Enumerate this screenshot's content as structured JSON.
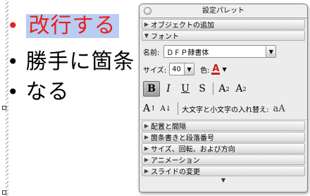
{
  "slide": {
    "lines": [
      {
        "bullet": "•",
        "text": "改行する"
      },
      {
        "bullet": "•",
        "text": "勝手に箇条"
      },
      {
        "bullet": "•",
        "text": "なる"
      }
    ],
    "highlight_text_color": "#e81e1e",
    "selection_color": "#b9cdf2"
  },
  "palette": {
    "title": "設定パレット",
    "sections_top": [
      {
        "label": "オブジェクトの追加",
        "state": "collapsed"
      },
      {
        "label": "フォント",
        "state": "expanded"
      }
    ],
    "font": {
      "name_label": "名前:",
      "name_value": "ＤＦＰ隷書体",
      "size_label": "サイズ:",
      "size_value": "40",
      "color_label": "色:",
      "color_value": "#c42020",
      "style_buttons": [
        {
          "id": "bold",
          "glyph": "B",
          "active": true
        },
        {
          "id": "italic",
          "glyph": "I",
          "active": false
        },
        {
          "id": "underline",
          "glyph": "U",
          "active": false
        },
        {
          "id": "strikethrough",
          "glyph": "S",
          "active": false
        },
        {
          "id": "superscript",
          "glyph": "A",
          "mark": "2",
          "active": false
        },
        {
          "id": "subscript",
          "glyph": "A",
          "mark": "2",
          "active": false
        }
      ],
      "case_label": "大文字と小文字の入れ替え:",
      "case_button": "aA",
      "grow_glyph": "A",
      "shrink_glyph": "A"
    },
    "sections_bottom": [
      {
        "label": "配置と間隔",
        "state": "collapsed"
      },
      {
        "label": "箇条書きと段落番号",
        "state": "collapsed"
      },
      {
        "label": "サイズ、回転、および方向",
        "state": "collapsed"
      },
      {
        "label": "アニメーション",
        "state": "collapsed"
      },
      {
        "label": "スライドの変更",
        "state": "collapsed"
      }
    ],
    "icons": {
      "collapsed": "▶",
      "expanded": "▼",
      "popup_arrow": "▼",
      "scroll_down": "▼"
    }
  }
}
